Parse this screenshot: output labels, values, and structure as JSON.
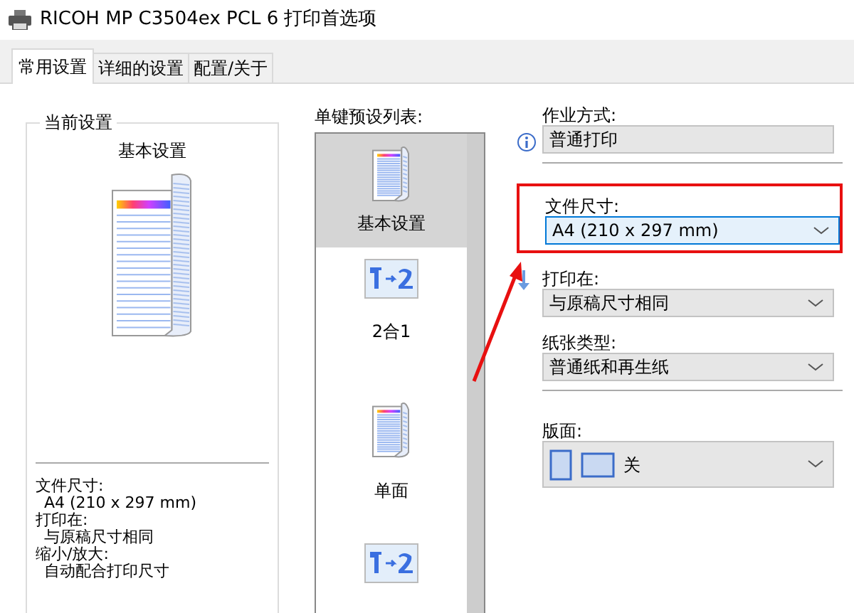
{
  "window": {
    "title": "RICOH MP C3504ex PCL 6 打印首选项"
  },
  "tabs": [
    {
      "label": "常用设置",
      "selected": true
    },
    {
      "label": "详细的设置",
      "selected": false
    },
    {
      "label": "配置/关于",
      "selected": false
    }
  ],
  "current_settings": {
    "title": "当前设置",
    "preview_title": "基本设置",
    "summary": [
      {
        "label": "文件尺寸:",
        "value": "A4 (210 x 297 mm)"
      },
      {
        "label": "打印在:",
        "value": "与原稿尺寸相同"
      },
      {
        "label": "缩小/放大:",
        "value": "自动配合打印尺寸"
      }
    ]
  },
  "presets": {
    "label": "单键预设列表:",
    "items": [
      {
        "label": "基本设置",
        "kind": "document",
        "selected": true
      },
      {
        "label": "2合1",
        "kind": "two-in-one",
        "selected": false
      },
      {
        "label": "单面",
        "kind": "document",
        "selected": false
      },
      {
        "kind": "two-in-one",
        "selected": false
      }
    ]
  },
  "fields": [
    {
      "label": "作业方式:",
      "value": "普通打印",
      "kind": "plain",
      "divider_after": true
    },
    {
      "label": "文件尺寸:",
      "value": "A4 (210 x 297 mm)",
      "kind": "dropdown",
      "focused": true,
      "annotated": true
    },
    {
      "label": "打印在:",
      "value": "与原稿尺寸相同",
      "kind": "dropdown"
    },
    {
      "label": "纸张类型:",
      "value": "普通纸和再生纸",
      "kind": "dropdown",
      "divider_after": true
    },
    {
      "label": "版面:",
      "value": "关",
      "kind": "layout-dropdown"
    }
  ]
}
